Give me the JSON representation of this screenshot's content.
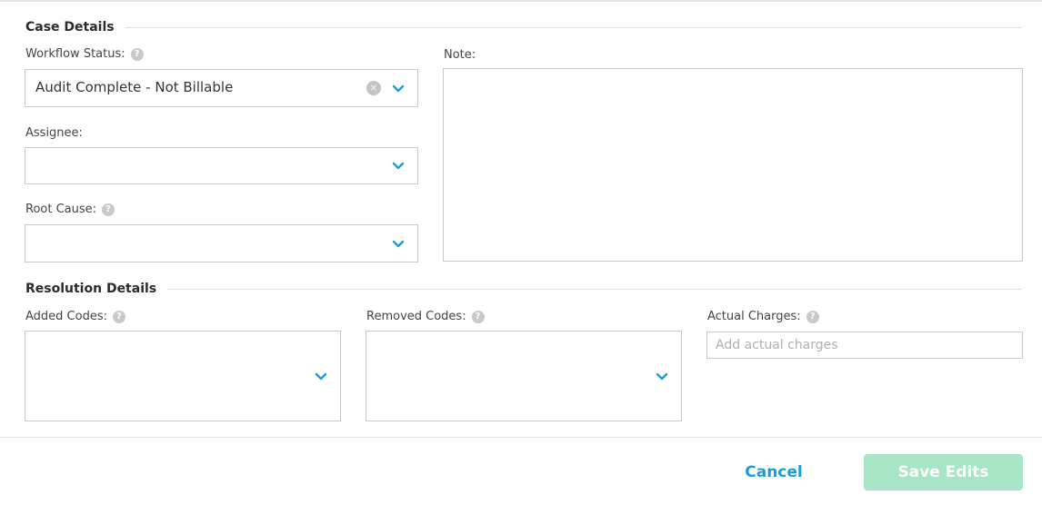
{
  "case_details": {
    "title": "Case Details",
    "workflow_status": {
      "label": "Workflow Status:",
      "value": "Audit Complete - Not Billable"
    },
    "assignee": {
      "label": "Assignee:",
      "value": ""
    },
    "root_cause": {
      "label": "Root Cause:",
      "value": ""
    },
    "note": {
      "label": "Note:",
      "value": ""
    }
  },
  "resolution_details": {
    "title": "Resolution Details",
    "added_codes": {
      "label": "Added Codes:",
      "value": ""
    },
    "removed_codes": {
      "label": "Removed Codes:",
      "value": ""
    },
    "actual_charges": {
      "label": "Actual Charges:",
      "placeholder": "Add actual charges",
      "value": ""
    }
  },
  "footer": {
    "cancel_label": "Cancel",
    "save_label": "Save Edits"
  },
  "icons": {
    "help": "?",
    "clear": "×"
  },
  "colors": {
    "accent": "#1a9de0",
    "save_disabled": "#a8e4c6",
    "chevron": "#1a9de0"
  }
}
